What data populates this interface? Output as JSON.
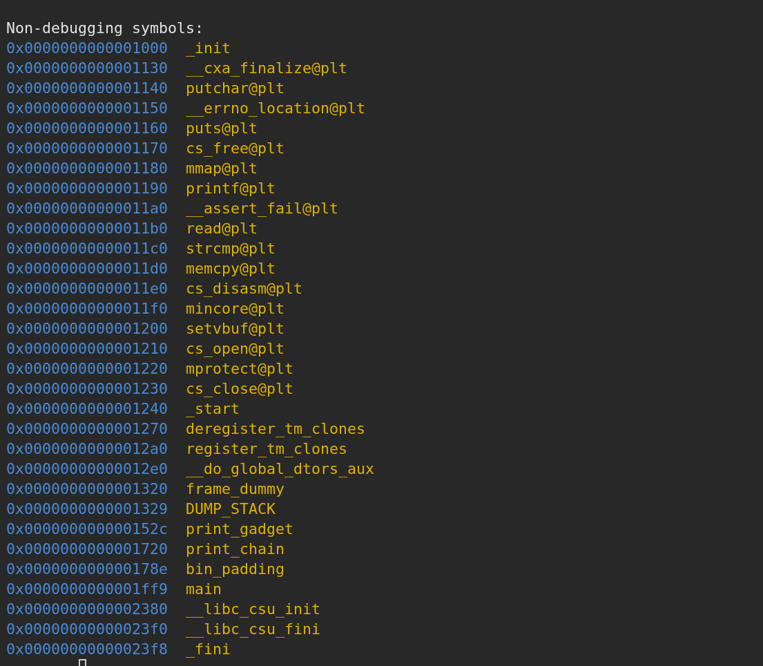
{
  "header": "Non-debugging symbols:",
  "symbols": [
    {
      "address": "0x0000000000001000",
      "name": "_init"
    },
    {
      "address": "0x0000000000001130",
      "name": "__cxa_finalize@plt"
    },
    {
      "address": "0x0000000000001140",
      "name": "putchar@plt"
    },
    {
      "address": "0x0000000000001150",
      "name": "__errno_location@plt"
    },
    {
      "address": "0x0000000000001160",
      "name": "puts@plt"
    },
    {
      "address": "0x0000000000001170",
      "name": "cs_free@plt"
    },
    {
      "address": "0x0000000000001180",
      "name": "mmap@plt"
    },
    {
      "address": "0x0000000000001190",
      "name": "printf@plt"
    },
    {
      "address": "0x00000000000011a0",
      "name": "__assert_fail@plt"
    },
    {
      "address": "0x00000000000011b0",
      "name": "read@plt"
    },
    {
      "address": "0x00000000000011c0",
      "name": "strcmp@plt"
    },
    {
      "address": "0x00000000000011d0",
      "name": "memcpy@plt"
    },
    {
      "address": "0x00000000000011e0",
      "name": "cs_disasm@plt"
    },
    {
      "address": "0x00000000000011f0",
      "name": "mincore@plt"
    },
    {
      "address": "0x0000000000001200",
      "name": "setvbuf@plt"
    },
    {
      "address": "0x0000000000001210",
      "name": "cs_open@plt"
    },
    {
      "address": "0x0000000000001220",
      "name": "mprotect@plt"
    },
    {
      "address": "0x0000000000001230",
      "name": "cs_close@plt"
    },
    {
      "address": "0x0000000000001240",
      "name": "_start"
    },
    {
      "address": "0x0000000000001270",
      "name": "deregister_tm_clones"
    },
    {
      "address": "0x00000000000012a0",
      "name": "register_tm_clones"
    },
    {
      "address": "0x00000000000012e0",
      "name": "__do_global_dtors_aux"
    },
    {
      "address": "0x0000000000001320",
      "name": "frame_dummy"
    },
    {
      "address": "0x0000000000001329",
      "name": "DUMP_STACK"
    },
    {
      "address": "0x000000000000152c",
      "name": "print_gadget"
    },
    {
      "address": "0x0000000000001720",
      "name": "print_chain"
    },
    {
      "address": "0x000000000000178e",
      "name": "bin_padding"
    },
    {
      "address": "0x0000000000001ff9",
      "name": "main"
    },
    {
      "address": "0x0000000000002380",
      "name": "__libc_csu_init"
    },
    {
      "address": "0x00000000000023f0",
      "name": "__libc_csu_fini"
    },
    {
      "address": "0x00000000000023f8",
      "name": "_fini"
    }
  ]
}
